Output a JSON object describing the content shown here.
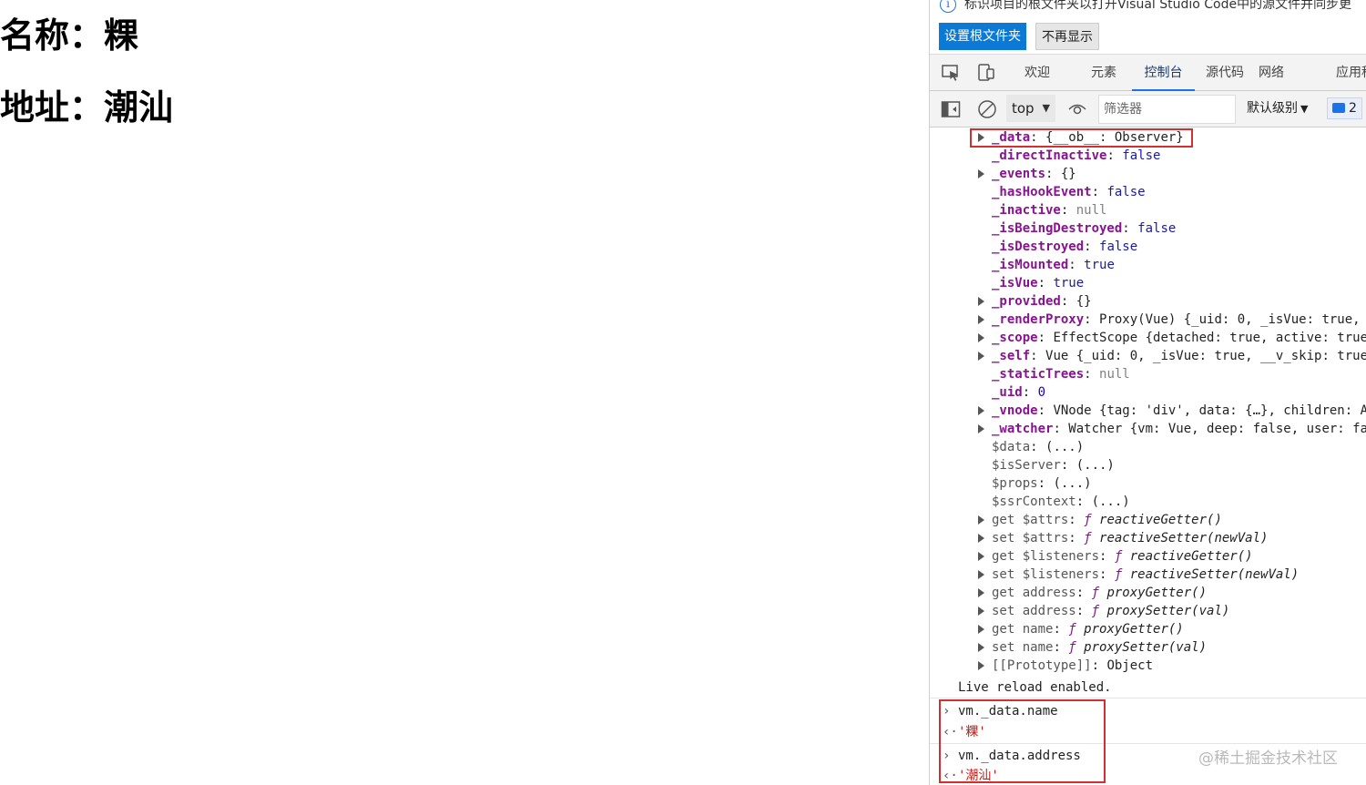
{
  "page": {
    "name_line": "名称：粿",
    "address_line": "地址：潮汕"
  },
  "devtools": {
    "info_icon": "info-icon",
    "info_text": "标识项目的根文件夹以打开Visual Studio Code中的源文件并同步更",
    "set_root_button": "设置根文件夹",
    "no_show_button": "不再显示",
    "tabs": {
      "welcome": "欢迎",
      "elements": "元素",
      "console": "控制台",
      "sources": "源代码",
      "network": "网络",
      "application": "应用程"
    },
    "toolbar": {
      "context": "top",
      "filter_placeholder": "筛选器",
      "level": "默认级别",
      "message_count": "2"
    },
    "properties": [
      {
        "key": "_data",
        "value": "{__ob__: Observer}"
      },
      {
        "key": "_directInactive",
        "value": "false"
      },
      {
        "key": "_events",
        "value": "{}"
      },
      {
        "key": "_hasHookEvent",
        "value": "false"
      },
      {
        "key": "_inactive",
        "value": "null"
      },
      {
        "key": "_isBeingDestroyed",
        "value": "false"
      },
      {
        "key": "_isDestroyed",
        "value": "false"
      },
      {
        "key": "_isMounted",
        "value": "true"
      },
      {
        "key": "_isVue",
        "value": "true"
      },
      {
        "key": "_provided",
        "value": "{}"
      },
      {
        "key": "_renderProxy",
        "value": "Proxy(Vue) {_uid: 0, _isVue: true, _"
      },
      {
        "key": "_scope",
        "value": "EffectScope {detached: true, active: true,"
      },
      {
        "key": "_self",
        "value": "Vue {_uid: 0, _isVue: true, __v_skip: true,"
      },
      {
        "key": "_staticTrees",
        "value": "null"
      },
      {
        "key": "_uid",
        "value": "0"
      },
      {
        "key": "_vnode",
        "value": "VNode {tag: 'div', data: {…}, children: Ar"
      },
      {
        "key": "_watcher",
        "value": "Watcher {vm: Vue, deep: false, user: fal"
      },
      {
        "key": "$data",
        "value": "(...)"
      },
      {
        "key": "$isServer",
        "value": "(...)"
      },
      {
        "key": "$props",
        "value": "(...)"
      },
      {
        "key": "$ssrContext",
        "value": "(...)"
      },
      {
        "key": "get $attrs",
        "value": "ƒ reactiveGetter()"
      },
      {
        "key": "set $attrs",
        "value": "ƒ reactiveSetter(newVal)"
      },
      {
        "key": "get $listeners",
        "value": "ƒ reactiveGetter()"
      },
      {
        "key": "set $listeners",
        "value": "ƒ reactiveSetter(newVal)"
      },
      {
        "key": "get address",
        "value": "ƒ proxyGetter()"
      },
      {
        "key": "set address",
        "value": "ƒ proxySetter(val)"
      },
      {
        "key": "get name",
        "value": "ƒ proxyGetter()"
      },
      {
        "key": "set name",
        "value": "ƒ proxySetter(val)"
      },
      {
        "key": "[[Prototype]]",
        "value": "Object"
      }
    ],
    "live_reload": "Live reload enabled.",
    "commands": [
      {
        "input": "vm._data.name",
        "output": "'粿'"
      },
      {
        "input": "vm._data.address",
        "output": "'潮汕'"
      }
    ]
  },
  "watermark": "@稀土掘金技术社区",
  "colors": {
    "primary_button": "#0a7ad6",
    "active_tab_underline": "#1a73e8",
    "highlight_box": "#d32f2f",
    "property_key": "#881391",
    "boolean_value": "#1a1aa6"
  }
}
